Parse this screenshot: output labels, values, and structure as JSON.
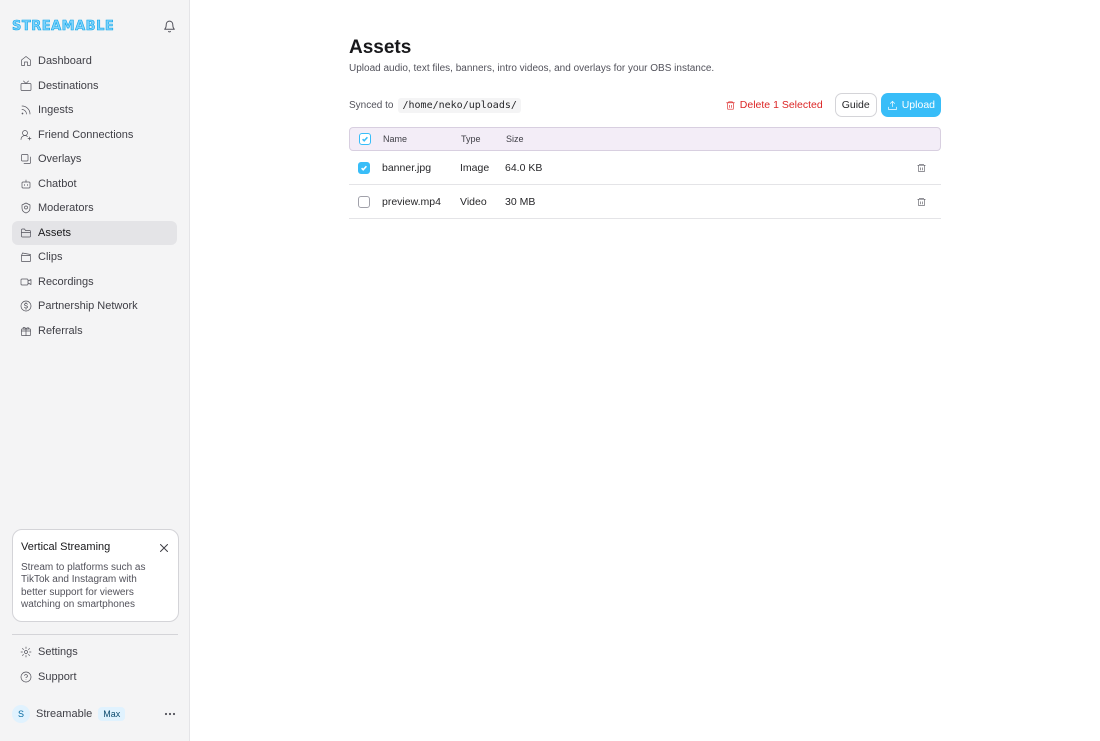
{
  "app": {
    "logo_text": "STREAMABLE"
  },
  "sidebar": {
    "items": [
      {
        "label": "Dashboard",
        "icon": "home-icon"
      },
      {
        "label": "Destinations",
        "icon": "tv-icon"
      },
      {
        "label": "Ingests",
        "icon": "rss-icon"
      },
      {
        "label": "Friend Connections",
        "icon": "user-icon"
      },
      {
        "label": "Overlays",
        "icon": "layers-icon"
      },
      {
        "label": "Chatbot",
        "icon": "bot-icon"
      },
      {
        "label": "Moderators",
        "icon": "shield-icon"
      },
      {
        "label": "Assets",
        "icon": "folder-icon",
        "active": true
      },
      {
        "label": "Clips",
        "icon": "clapper-icon"
      },
      {
        "label": "Recordings",
        "icon": "video-icon"
      },
      {
        "label": "Partnership Network",
        "icon": "dollar-icon"
      },
      {
        "label": "Referrals",
        "icon": "gift-icon"
      }
    ],
    "promo": {
      "title": "Vertical Streaming",
      "text": "Stream to platforms such as TikTok and Instagram with better support for viewers watching on smartphones"
    },
    "bottom_items": [
      {
        "label": "Settings",
        "icon": "gear-icon"
      },
      {
        "label": "Support",
        "icon": "help-icon"
      }
    ],
    "user": {
      "initial": "S",
      "name": "Streamable",
      "plan": "Max"
    }
  },
  "main": {
    "title": "Assets",
    "subtitle": "Upload audio, text files, banners, intro videos, and overlays for your OBS instance.",
    "synced_label": "Synced to",
    "synced_path": "/home/neko/uploads/",
    "delete_selected_label": "Delete 1 Selected",
    "guide_label": "Guide",
    "upload_label": "Upload",
    "table": {
      "headers": {
        "name": "Name",
        "type": "Type",
        "size": "Size"
      },
      "rows": [
        {
          "name": "banner.jpg",
          "type": "Image",
          "size": "64.0 KB",
          "checked": true
        },
        {
          "name": "preview.mp4",
          "type": "Video",
          "size": "30 MB",
          "checked": false
        }
      ]
    }
  },
  "colors": {
    "accent": "#38bdf8",
    "danger": "#dc2626",
    "sidebar_bg": "#f4f4f5"
  }
}
